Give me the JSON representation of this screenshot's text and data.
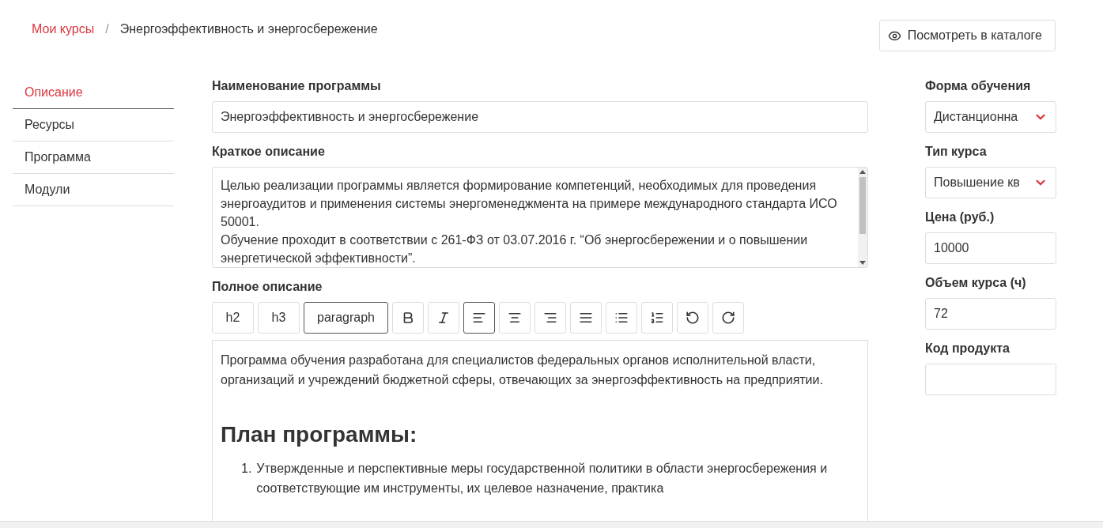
{
  "breadcrumb": [
    {
      "label": "Мои курсы",
      "link": true
    },
    {
      "label": "Энергоэффективность и энергосбережение",
      "link": false
    }
  ],
  "breadcrumb_separator": "/",
  "catalog_button": {
    "label": "Посмотреть в каталоге"
  },
  "sidebar": {
    "items": [
      {
        "label": "Описание",
        "selected": true
      },
      {
        "label": "Ресурсы",
        "selected": false
      },
      {
        "label": "Программа",
        "selected": false
      },
      {
        "label": "Модули",
        "selected": false
      }
    ]
  },
  "program_name": {
    "label": "Наименование программы",
    "value": "Энергоэффективность и энергосбережение"
  },
  "short_description": {
    "label": "Краткое описание",
    "paragraphs": [
      "Целью реализации программы является формирование компетенций, необходимых для проведения энергоаудитов и применения системы энергоменеджмента на примере международного стандарта ИСО 50001.",
      "Обучение проходит в соответствии с 261-ФЗ от 03.07.2016 г. “Об энергосбережении и о повышении энергетической эффективности”."
    ]
  },
  "full_description": {
    "label": "Полное описание",
    "toolbar": [
      {
        "kind": "text",
        "label": "h2",
        "selected": false
      },
      {
        "kind": "text",
        "label": "h3",
        "selected": false
      },
      {
        "kind": "text",
        "label": "paragraph",
        "selected": true
      },
      {
        "kind": "bold",
        "selected": false
      },
      {
        "kind": "italic",
        "selected": false
      },
      {
        "kind": "alignleft",
        "selected": true
      },
      {
        "kind": "aligncenter",
        "selected": false
      },
      {
        "kind": "alignright",
        "selected": false
      },
      {
        "kind": "justify",
        "selected": false
      },
      {
        "kind": "bullets",
        "selected": false
      },
      {
        "kind": "numbers",
        "selected": false
      },
      {
        "kind": "undo",
        "selected": false
      },
      {
        "kind": "redo",
        "selected": false
      }
    ],
    "content": [
      {
        "kind": "paragraph",
        "text": "Программа обучения разработана для специалистов федеральных органов исполнительной власти, организаций и учреждений бюджетной сферы, отвечающих за энергоэффективность на предприятии."
      },
      {
        "kind": "blank"
      },
      {
        "kind": "heading",
        "text": "План программы:"
      },
      {
        "kind": "listitem",
        "number": "1.",
        "text": "Утвержденные и перспективные меры государственной политики в области энергосбережения и соответствующие им инструменты, их целевое назначение, практика"
      }
    ]
  },
  "side_fields": [
    {
      "kind": "select",
      "label": "Форма обучения",
      "value": "Дистанционна"
    },
    {
      "kind": "select",
      "label": "Тип курса",
      "value": "Повышение кв"
    },
    {
      "kind": "input",
      "label": "Цена (руб.)",
      "value": "10000"
    },
    {
      "kind": "input",
      "label": "Объем курса (ч)",
      "value": "72"
    },
    {
      "kind": "input",
      "label": "Код продукта"
    }
  ]
}
